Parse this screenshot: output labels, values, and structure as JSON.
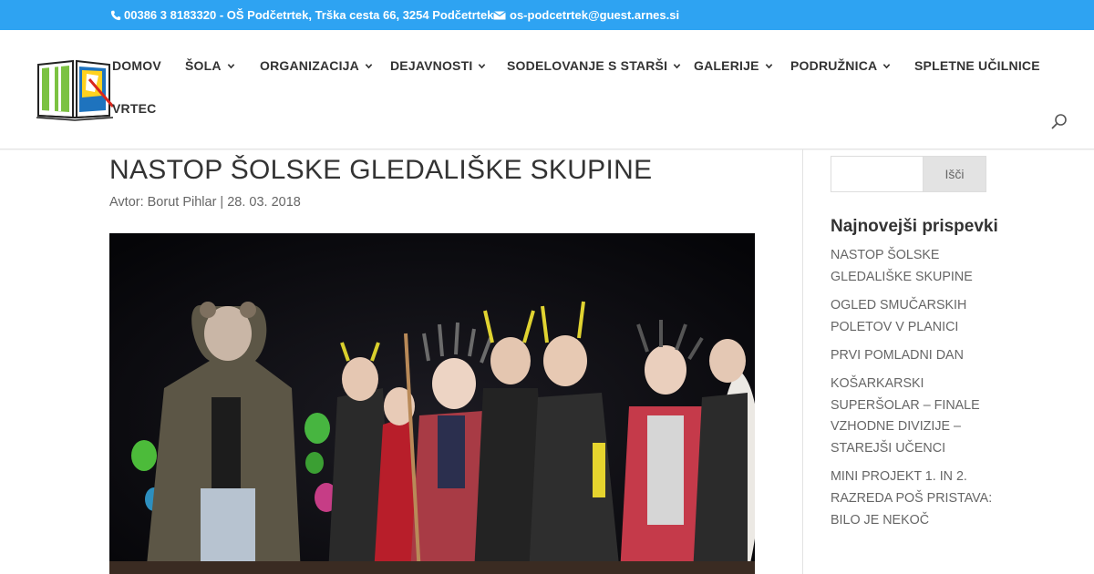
{
  "topbar": {
    "phone": "00386 3 8183320 - OŠ Podčetrtek, Trška cesta 66, 3254 Podčetrtek",
    "email": "os-podcetrtek@guest.arnes.si",
    "background": "#2ea3f2",
    "phone_icon": "phone-icon",
    "email_icon": "envelope-icon"
  },
  "nav": {
    "items": [
      {
        "label": "DOMOV",
        "dropdown": false
      },
      {
        "label": "ŠOLA",
        "dropdown": true
      },
      {
        "label": "ORGANIZACIJA",
        "dropdown": true
      },
      {
        "label": "DEJAVNOSTI",
        "dropdown": true
      },
      {
        "label": "SODELOVANJE S STARŠI",
        "dropdown": true
      },
      {
        "label": "GALERIJE",
        "dropdown": true
      },
      {
        "label": "PODRUŽNICA",
        "dropdown": true
      },
      {
        "label": "SPLETNE UČILNICE",
        "dropdown": false
      },
      {
        "label": "VRTEC",
        "dropdown": false
      }
    ]
  },
  "post": {
    "title": "NASTOP ŠOLSKE GLEDALIŠKE SKUPINE",
    "meta": "Avtor: Borut Pihlar | 28. 03. 2018"
  },
  "sidebar": {
    "search_button": "Išči",
    "search_value": "",
    "recent_title": "Najnovejši prispevki",
    "recent_posts": [
      "NASTOP ŠOLSKE GLEDALIŠKE SKUPINE",
      "OGLED SMUČARSKIH POLETOV V PLANICI",
      "PRVI POMLADNI DAN",
      "KOŠARKARSKI SUPERŠOLAR – FINALE VZHODNE DIVIZIJE – STAREJŠI UČENCI",
      "MINI PROJEKT 1. IN 2. RAZREDA POŠ PRISTAVA: BILO JE NEKOČ"
    ]
  }
}
